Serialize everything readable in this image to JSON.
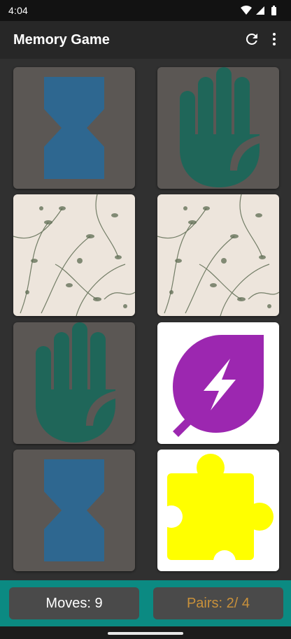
{
  "status_bar": {
    "time": "4:04",
    "icons": [
      "wifi-icon",
      "signal-icon",
      "battery-icon"
    ]
  },
  "app_bar": {
    "title": "Memory Game",
    "actions": [
      "refresh-icon",
      "more-vert-icon"
    ]
  },
  "cards": [
    {
      "state": "revealed",
      "icon": "hourglass-icon",
      "color": "#2e6790",
      "background": "#5b5754"
    },
    {
      "state": "revealed",
      "icon": "hand-icon",
      "color": "#1f6659",
      "background": "#5b5754"
    },
    {
      "state": "hidden",
      "icon": "floral-card-back",
      "color": "#5d6b52",
      "background": "#ede5dc"
    },
    {
      "state": "hidden",
      "icon": "floral-card-back",
      "color": "#5d6b52",
      "background": "#ede5dc"
    },
    {
      "state": "revealed",
      "icon": "hand-icon",
      "color": "#1f6659",
      "background": "#5b5754"
    },
    {
      "state": "matched",
      "icon": "leaf-bolt-icon",
      "color": "#9c27b0",
      "background": "#ffffff"
    },
    {
      "state": "revealed",
      "icon": "hourglass-icon",
      "color": "#2e6790",
      "background": "#5b5754"
    },
    {
      "state": "matched",
      "icon": "puzzle-icon",
      "color": "#ffff00",
      "background": "#ffffff"
    }
  ],
  "footer": {
    "moves_label": "Moves: 9",
    "pairs_label": "Pairs: 2/ 4",
    "accent": "#0b8a82"
  }
}
